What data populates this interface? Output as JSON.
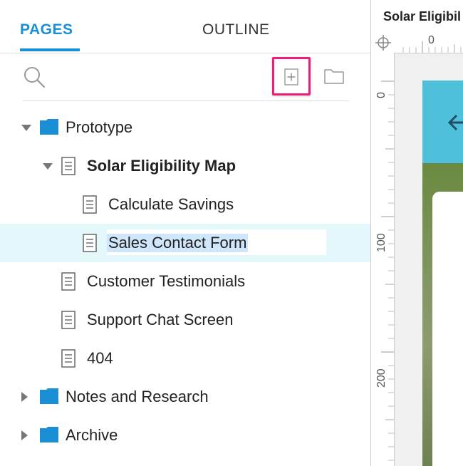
{
  "tabs": {
    "pages": "PAGES",
    "outline": "OUTLINE"
  },
  "toolbar": {
    "search_icon": "search-icon",
    "add_page_icon": "add-page-icon",
    "add_folder_icon": "add-folder-icon"
  },
  "tree": [
    {
      "label": "Prototype",
      "type": "folder",
      "expanded": true
    },
    {
      "label": "Solar Eligibility Map",
      "type": "page",
      "expanded": true,
      "bold": true
    },
    {
      "label": "Calculate Savings",
      "type": "page"
    },
    {
      "label": "Sales Contact Form",
      "type": "page",
      "selected": true,
      "editing": true
    },
    {
      "label": "Customer Testimonials",
      "type": "page"
    },
    {
      "label": "Support Chat Screen",
      "type": "page"
    },
    {
      "label": "404",
      "type": "page"
    },
    {
      "label": "Notes and Research",
      "type": "folder",
      "expanded": false
    },
    {
      "label": "Archive",
      "type": "folder",
      "expanded": false
    }
  ],
  "canvas": {
    "doc_tab": "Solar Eligibil",
    "ruler_top_zero": "0",
    "ruler_left": [
      "0",
      "100",
      "200"
    ]
  },
  "colors": {
    "accent": "#1a8fd6",
    "highlight": "#ec1e78",
    "folder": "#1a8fd6",
    "selection": "#e4f8fb"
  }
}
